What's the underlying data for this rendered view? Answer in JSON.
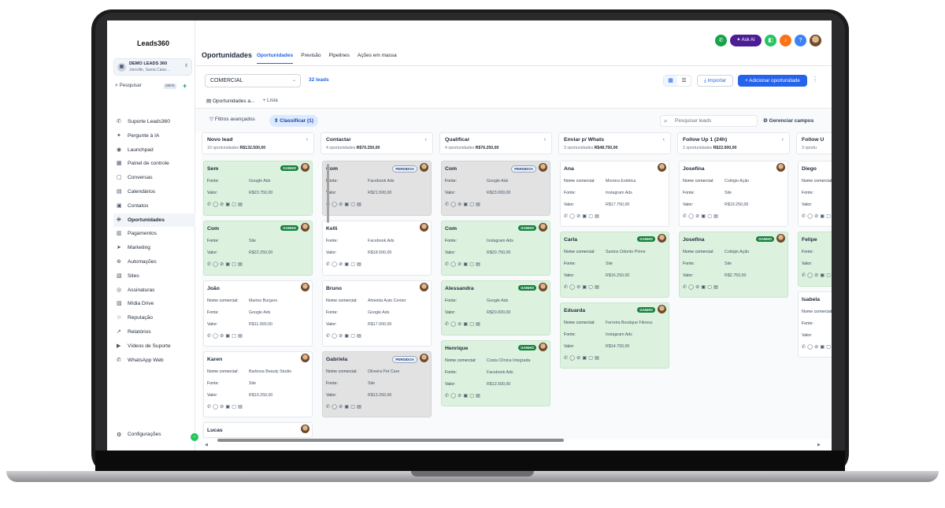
{
  "app": {
    "logo": "Leads360"
  },
  "workspace": {
    "name": "DEMO LEADS 360",
    "location": "Joinville, Santa Catar..."
  },
  "search": {
    "label": "Pesquisar",
    "shortcut": "ctrl+k",
    "plus": "+"
  },
  "sidebar": {
    "items": [
      {
        "label": "Suporte Leads360",
        "icon": "whatsapp-icon",
        "glyph": "✆"
      },
      {
        "label": "Pergunte à IA",
        "icon": "sparkle-icon",
        "glyph": "✦"
      },
      {
        "label": "Launchpad",
        "icon": "rocket-icon",
        "glyph": "◉"
      },
      {
        "label": "Painel de controle",
        "icon": "dashboard-icon",
        "glyph": "▦"
      },
      {
        "label": "Conversas",
        "icon": "chat-icon",
        "glyph": "▢"
      },
      {
        "label": "Calendários",
        "icon": "calendar-icon",
        "glyph": "▤"
      },
      {
        "label": "Contatos",
        "icon": "contacts-icon",
        "glyph": "▣"
      },
      {
        "label": "Oportunidades",
        "icon": "funnel-icon",
        "glyph": "⁜"
      },
      {
        "label": "Pagamentos",
        "icon": "payments-icon",
        "glyph": "▥"
      },
      {
        "label": "Marketing",
        "icon": "send-icon",
        "glyph": "➤"
      },
      {
        "label": "Automações",
        "icon": "automation-icon",
        "glyph": "⊛"
      },
      {
        "label": "Sites",
        "icon": "sites-icon",
        "glyph": "▧"
      },
      {
        "label": "Assinaturas",
        "icon": "badge-icon",
        "glyph": "◎"
      },
      {
        "label": "Mídia Drive",
        "icon": "media-icon",
        "glyph": "▨"
      },
      {
        "label": "Reputação",
        "icon": "star-icon",
        "glyph": "☆"
      },
      {
        "label": "Relatórios",
        "icon": "chart-icon",
        "glyph": "↗"
      },
      {
        "label": "Vídeos de Suporte",
        "icon": "video-icon",
        "glyph": "▶"
      },
      {
        "label": "WhatsApp Web",
        "icon": "whatsapp-icon",
        "glyph": "✆"
      }
    ],
    "settings": "Configurações"
  },
  "header": {
    "title": "Oportunidades",
    "tabs": [
      "Oportunidades",
      "Previsão",
      "Pipelines",
      "Ações em massa"
    ],
    "ask_ai": "✦ Ask AI"
  },
  "toolbar": {
    "pipeline": "COMERCIAL",
    "leads_count": "32 leads",
    "import": "Importar",
    "add": "+ Adicionar oportunidade"
  },
  "views": {
    "tab1": "Oportunidades a...",
    "tab2": "+ Lista"
  },
  "filters": {
    "advanced": "Filtros avançados",
    "classify": "⇕ Classificar (1)",
    "search_placeholder": "Pesquisar leads",
    "manage": "Gerenciar campos"
  },
  "labels": {
    "fonte": "Fonte:",
    "valor": "Valor:",
    "nome": "Nome comercial:",
    "won": "GANHO",
    "lost": "PERDIDOA",
    "actions": "✆◯⊘▣▢▤"
  },
  "columns": [
    {
      "title": "Novo lead",
      "count": "10 oportunidades",
      "total": "R$132.500,00",
      "cards": [
        {
          "name": "Sem",
          "status": "won",
          "fonte": "Google Ads",
          "valor": "R$23.750,00"
        },
        {
          "name": "Com",
          "status": "won",
          "fonte": "Site",
          "valor": "R$22.250,00"
        },
        {
          "name": "João",
          "status": "",
          "nome": "Martes Burgers",
          "fonte": "Google Ads",
          "valor": "R$11.000,00"
        },
        {
          "name": "Karen",
          "status": "",
          "nome": "Barbosa Beauty Studio",
          "fonte": "Site",
          "valor": "R$10.250,00"
        },
        {
          "name": "Lucas",
          "status": ""
        }
      ]
    },
    {
      "title": "Contactar",
      "count": "4 oportunidades",
      "total": "R$70.250,00",
      "cards": [
        {
          "name": "Com",
          "status": "lost",
          "fonte": "Facebook Ads",
          "valor": "R$21.500,00"
        },
        {
          "name": "Kelli",
          "status": "",
          "fonte": "Facebook Ads",
          "valor": "R$18.500,00"
        },
        {
          "name": "Bruno",
          "status": "",
          "nome": "Almeida Auto Center",
          "fonte": "Google Ads",
          "valor": "R$17.000,00"
        },
        {
          "name": "Gabriela",
          "status": "lost",
          "nome": "Oliveira Pet Care",
          "fonte": "Site",
          "valor": "R$13.250,00"
        }
      ]
    },
    {
      "title": "Qualificar",
      "count": "4 oportunidades",
      "total": "R$76.250,00",
      "cards": [
        {
          "name": "Com",
          "status": "lost",
          "fonte": "Google Ads",
          "valor": "R$23.000,00"
        },
        {
          "name": "Com",
          "status": "won",
          "fonte": "Instagram Ads",
          "valor": "R$20.750,00"
        },
        {
          "name": "Alessandra",
          "status": "won",
          "fonte": "Google Ads",
          "valor": "R$20.000,00"
        },
        {
          "name": "Henrique",
          "status": "won",
          "nome": "Costa Clínica Integrada",
          "fonte": "Facebook Ads",
          "valor": "R$12.500,00"
        }
      ]
    },
    {
      "title": "Enviar p/ Whats",
      "count": "3 oportunidades",
      "total": "R$48.750,00",
      "cards": [
        {
          "name": "Ana",
          "status": "",
          "nome": "Moreira Estética",
          "fonte": "Instagram Ads",
          "valor": "R$17.750,00"
        },
        {
          "name": "Carla",
          "status": "won",
          "nome": "Santos Odonto Prime",
          "fonte": "Site",
          "valor": "R$16.250,00"
        },
        {
          "name": "Eduarda",
          "status": "won",
          "nome": "Ferreira Boutique Fitness",
          "fonte": "Instagram Ads",
          "valor": "R$14.750,00"
        }
      ]
    },
    {
      "title": "Follow Up 1 (24h)",
      "count": "2 oportunidades",
      "total": "R$22.000,00",
      "cards": [
        {
          "name": "Josefina",
          "status": "",
          "nome": "Colégio Ação",
          "fonte": "Site",
          "valor": "R$19.250,00"
        },
        {
          "name": "Josefina",
          "status": "won",
          "nome": "Colégio Ação",
          "fonte": "Site",
          "valor": "R$2.750,00"
        }
      ]
    },
    {
      "title": "Follow U",
      "count": "3 oportu",
      "total": "",
      "cards": [
        {
          "name": "Diego",
          "status": "",
          "nome": "",
          "fonte": "",
          "valor": ""
        },
        {
          "name": "Felipe",
          "status": "won",
          "fonte": "",
          "valor": ""
        },
        {
          "name": "Isabela",
          "status": "",
          "nome": "",
          "fonte": "",
          "valor": ""
        }
      ]
    }
  ]
}
